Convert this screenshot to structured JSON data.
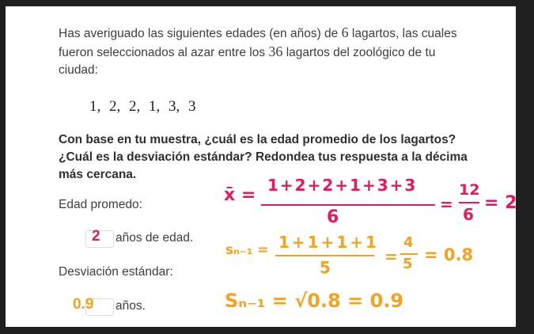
{
  "intro": {
    "part1": "Has averiguado las siguientes edades (en años) de ",
    "n_sample": "6",
    "part2": " lagartos, las cuales fueron seleccionados al azar entre los ",
    "n_total": "36",
    "part3": " lagartos del zoológico de tu ciudad:"
  },
  "data_values": "1,  2,  2,  1,  3,  3",
  "question": "Con base en tu muestra, ¿cuál es la edad promedio de los lagartos? ¿Cuál es la desviación estándar? Redondea tus respuesta a la décima más cercana.",
  "mean": {
    "label": "Edad promedo:",
    "answer": "2",
    "unit": "años de edad."
  },
  "sd": {
    "label": "Desviación estándar:",
    "answer": "0.9",
    "unit": "años."
  },
  "annotations": {
    "mean_lhs": "x̄ =",
    "mean_num": "1+2+2+1+3+3",
    "mean_den": "6",
    "mean_eq": "=",
    "mean_frac_num": "12",
    "mean_frac_den": "6",
    "mean_result": "= 2",
    "var_lhs": "sₙ₋₁ =",
    "var_num": "1+1+1+1",
    "var_den": "5",
    "var_eq": "=",
    "var_frac_num": "4",
    "var_frac_den": "5",
    "var_result": "= 0.8",
    "sd_line": "Sₙ₋₁ = √0.8 = 0.9"
  },
  "colors": {
    "pink": "#e5195e",
    "orange": "#f5a21c"
  }
}
